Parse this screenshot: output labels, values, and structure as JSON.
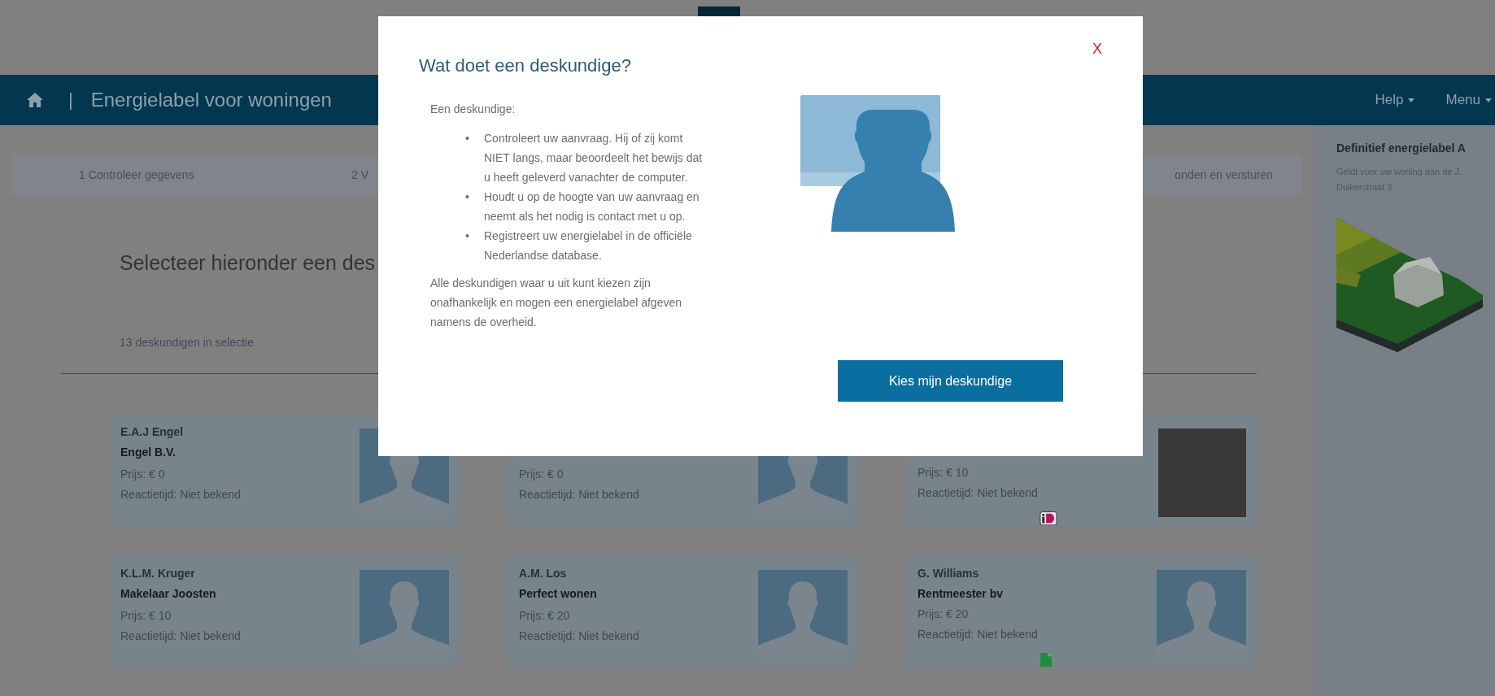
{
  "header": {
    "separator": "|",
    "title": "Energielabel voor woningen",
    "nav": [
      {
        "label": "Help"
      },
      {
        "label": "Menu"
      }
    ]
  },
  "steps": [
    {
      "label": "1 Controleer gegevens"
    },
    {
      "label": "2 V"
    },
    {
      "label": "onden en versturen"
    }
  ],
  "main": {
    "heading": "Selecteer hieronder een des",
    "count": "13 deskundigen in selectie",
    "cards": [
      {
        "name": "E.A.J Engel",
        "company": "Engel B.V.",
        "price": "Prijs: € 0",
        "reaction": "Reactietijd: Niet bekend",
        "kind": "plain"
      },
      {
        "price": "Prijs: € 0",
        "reaction": "Reactietijd: Niet bekend",
        "kind": "plain"
      },
      {
        "price": "Prijs: € 10",
        "reaction": "Reactietijd: Niet bekend",
        "kind": "photo"
      },
      {
        "name": "K.L.M. Kruger",
        "company": "Makelaar Joosten",
        "price": "Prijs: € 10",
        "reaction": "Reactietijd: Niet bekend",
        "kind": "plain"
      },
      {
        "name": "A.M. Los",
        "company": "Perfect wonen",
        "price": "Prijs: € 20",
        "reaction": "Reactietijd: Niet bekend",
        "kind": "plain"
      },
      {
        "name": "G. Williams",
        "company": "Rentmeester bv",
        "price": "Prijs: € 20",
        "reaction": "Reactietijd: Niet bekend",
        "kind": "document"
      }
    ]
  },
  "sidebar": {
    "title": "Definitief energielabel A",
    "text": "Geldt voor uw woning aan de J. Duikerstraat 3."
  },
  "modal": {
    "title": "Wat doet een deskundige?",
    "close": "X",
    "intro": "Een deskundige:",
    "bullets": [
      {
        "marker": "•",
        "text": "Controleert uw aanvraag. Hij of zij komt NIET langs, maar beoordeelt het bewijs dat u heeft geleverd vanachter de computer."
      },
      {
        "marker": "•",
        "text": "Houdt u op de hoogte van uw aanvraag en neemt als het nodig is contact met u op."
      },
      {
        "marker": "•",
        "text": "Registreert uw energielabel in de officiële Nederlandse database."
      }
    ],
    "paragraph": "Alle deskundigen waar u uit kunt kiezen zijn onafhankelijk en mogen een energielabel afgeven namens de overheid.",
    "button": "Kies mijn deskundige"
  }
}
